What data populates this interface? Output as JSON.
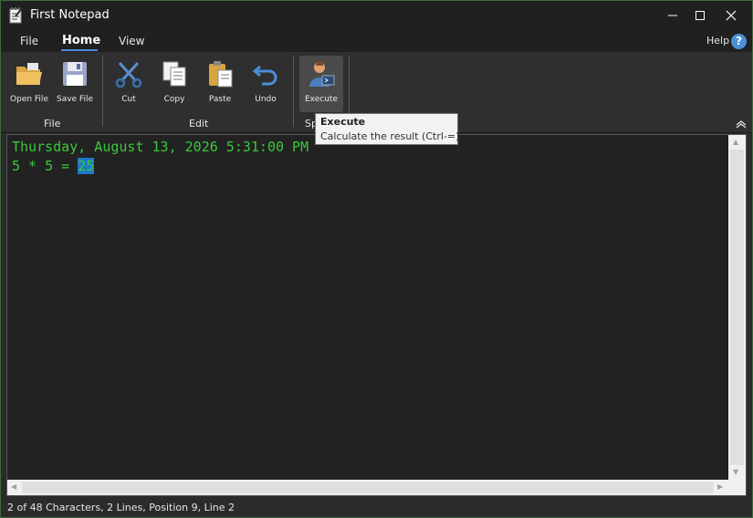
{
  "window": {
    "title": "First Notepad"
  },
  "tabs": {
    "file": "File",
    "home": "Home",
    "view": "View",
    "help": "Help",
    "help_symbol": "?"
  },
  "ribbon": {
    "open_file": "Open File",
    "save_file": "Save File",
    "cut": "Cut",
    "copy": "Copy",
    "paste": "Paste",
    "undo": "Undo",
    "execute": "Execute",
    "group_file": "File",
    "group_edit": "Edit",
    "group_special": "Sp"
  },
  "editor": {
    "line1": "Thursday, August 13, 2026 5:31:00 PM",
    "line2_prefix": "5 * 5 = ",
    "line2_selected": "25"
  },
  "tooltip": {
    "title": "Execute",
    "description": "Calculate the result (Ctrl-=)"
  },
  "status": {
    "text": "2 of 48 Characters, 2 Lines, Position 9, Line 2"
  },
  "colors": {
    "editor_text": "#3cc83c",
    "selection": "#1e78c8",
    "editor_bg": "#222222"
  }
}
